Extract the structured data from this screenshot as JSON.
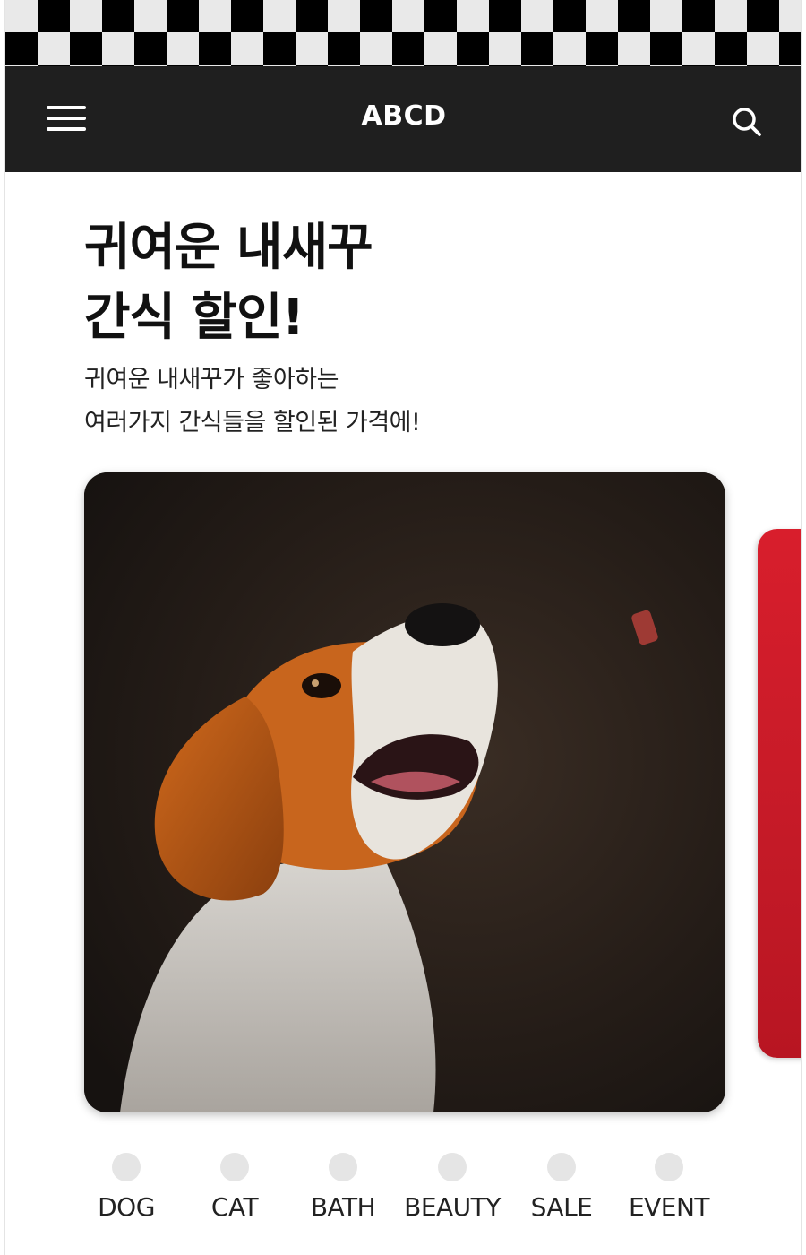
{
  "app": {
    "title": "ABCD"
  },
  "header": {
    "menu_icon": "hamburger-menu-icon",
    "search_icon": "search-icon"
  },
  "promo": {
    "headline": [
      "귀여운 내새꾸",
      "간식 할인!"
    ],
    "description": [
      "귀여운 내새꾸가 좋아하는",
      "여러가지 간식들을 할인된 가격에!"
    ]
  },
  "categories": [
    {
      "label": "DOG"
    },
    {
      "label": "CAT"
    },
    {
      "label": "BATH"
    },
    {
      "label": "BEAUTY"
    },
    {
      "label": "SALE"
    },
    {
      "label": "EVENT"
    }
  ],
  "colors": {
    "topbar": "#1f1f1f",
    "accent_card": "#d81e2c",
    "category_dot": "#e5e5e5"
  }
}
